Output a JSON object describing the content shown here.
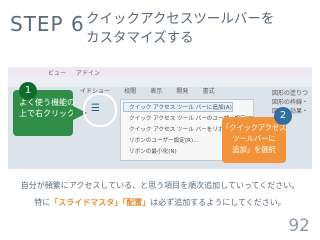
{
  "step": "STEP 6",
  "heading": "クイックアクセスツールバーを\nカスタマイズする",
  "screenshot": {
    "ribbon_menu": [
      "ビュー",
      "アドイン"
    ],
    "tabs": [
      "イドショー",
      "校閲",
      "表示",
      "開発",
      "書式"
    ],
    "right_panel": [
      "図形の塗りつ",
      "図形の枠線・",
      "図形の効果・"
    ],
    "popup_items": [
      "クイック アクセス ツール バーに追加(A)",
      "クイック アクセス ツール バーのユーザー設定(C)...",
      "クイック アクセス ツール バーをリボンの下に表示(S)",
      "リボンのユーザー設定(R)...",
      "リボンの最小化(N)"
    ]
  },
  "callout1": {
    "number": "1",
    "text": "よく使う機能の\n上で右クリック"
  },
  "callout2": {
    "number": "2",
    "text": "「クイックアクセス\nツールバーに\n追加」を選択"
  },
  "body_line1": "自分が頻繁にアクセスしている、と思う項目を順次追加していってください。",
  "body_line2_pre": "特に",
  "body_em1": "「スライドマスタ」",
  "body_em2": "「配置」",
  "body_line2_post": "は必ず追加するようにしてください。",
  "page_number": "92",
  "colors": {
    "green": "#2f8d47",
    "orange": "#f2933a",
    "title": "#5a6a78"
  }
}
